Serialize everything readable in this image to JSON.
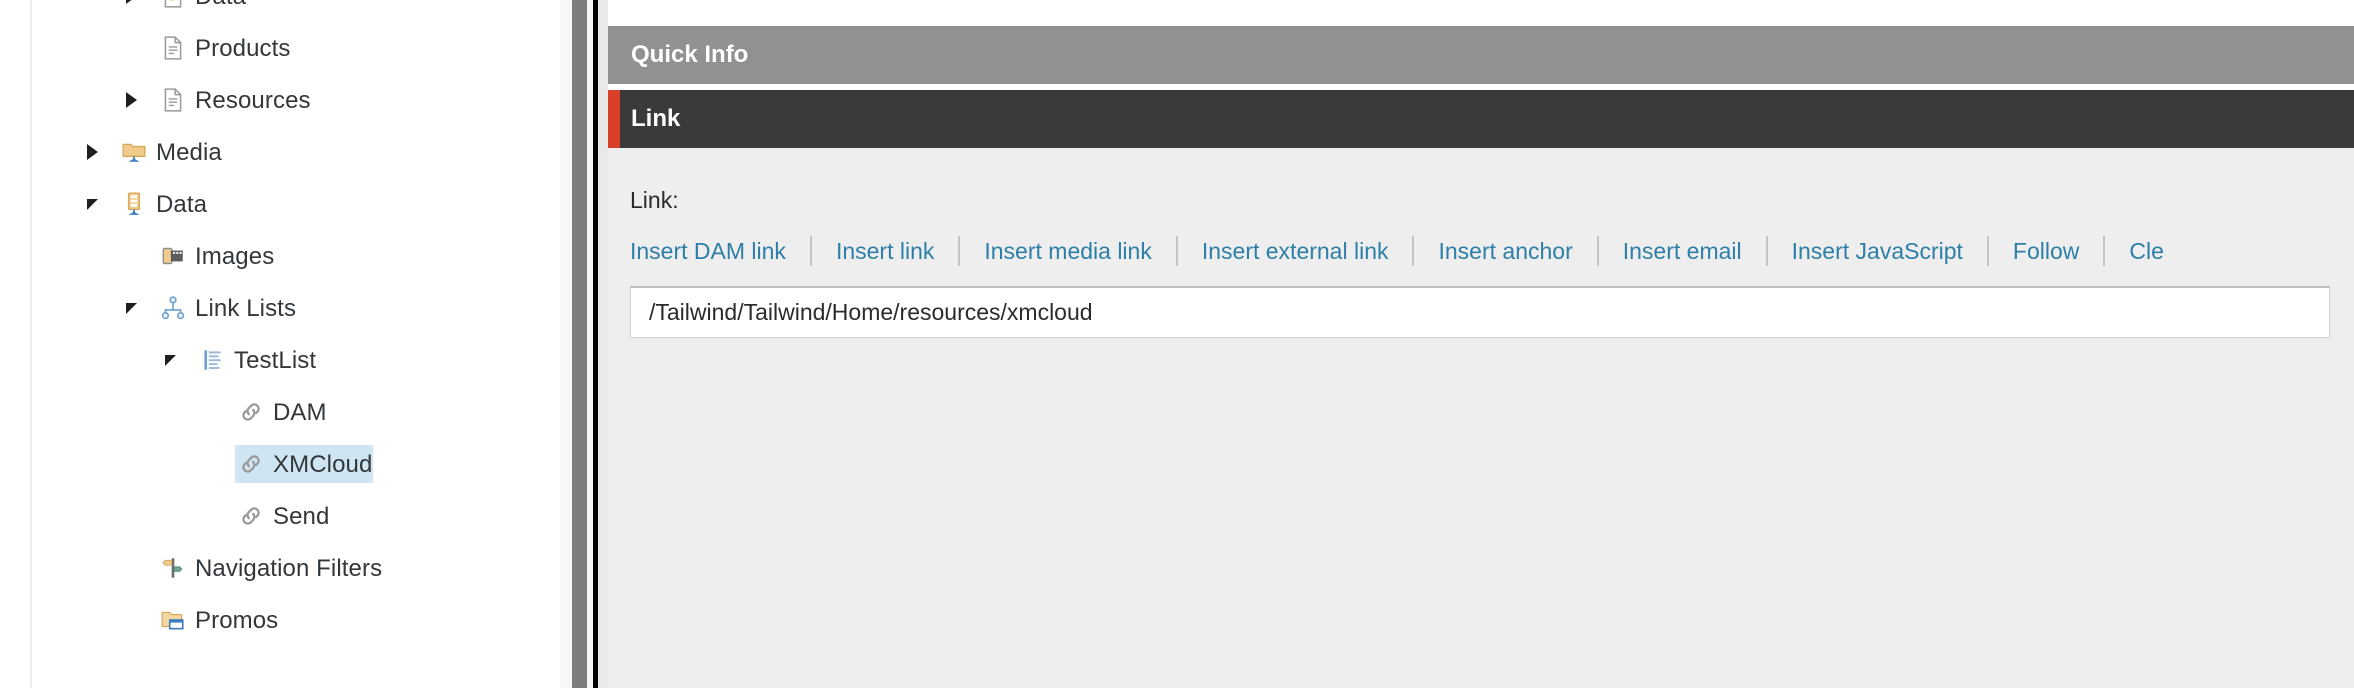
{
  "tree": {
    "name": "content-tree",
    "items": [
      {
        "label": "Data",
        "icon": "document-data-icon",
        "toggle": "collapsed",
        "indent": 3,
        "selected": false,
        "clipped": false
      },
      {
        "label": "Products",
        "icon": "document-icon",
        "toggle": "none",
        "indent": 3,
        "selected": false,
        "clipped": false
      },
      {
        "label": "Resources",
        "icon": "document-icon",
        "toggle": "collapsed",
        "indent": 3,
        "selected": false,
        "clipped": false
      },
      {
        "label": "Media",
        "icon": "media-folder-icon",
        "toggle": "collapsed",
        "indent": 2,
        "selected": false,
        "clipped": false
      },
      {
        "label": "Data",
        "icon": "data-drawer-icon",
        "toggle": "expanded",
        "indent": 2,
        "selected": false,
        "clipped": false
      },
      {
        "label": "Images",
        "icon": "film-roll-icon",
        "toggle": "none",
        "indent": 3,
        "selected": false,
        "clipped": false
      },
      {
        "label": "Link Lists",
        "icon": "node-tree-icon",
        "toggle": "expanded",
        "indent": 3,
        "selected": false,
        "clipped": false
      },
      {
        "label": "TestList",
        "icon": "list-lines-icon",
        "toggle": "expanded",
        "indent": 4,
        "selected": false,
        "clipped": false
      },
      {
        "label": "DAM",
        "icon": "chain-link-icon",
        "toggle": "none",
        "indent": 5,
        "selected": false,
        "clipped": false
      },
      {
        "label": "XMCloud",
        "icon": "chain-link-icon",
        "toggle": "none",
        "indent": 5,
        "selected": true,
        "clipped": false
      },
      {
        "label": "Send",
        "icon": "chain-link-icon",
        "toggle": "none",
        "indent": 5,
        "selected": false,
        "clipped": false
      },
      {
        "label": "Navigation Filters",
        "icon": "signpost-icon",
        "toggle": "none",
        "indent": 3,
        "selected": false,
        "clipped": false
      },
      {
        "label": "Promos",
        "icon": "folder-window-icon",
        "toggle": "none",
        "indent": 3,
        "selected": false,
        "clipped": false
      }
    ]
  },
  "sections": {
    "quick_info": {
      "title": "Quick Info"
    },
    "link": {
      "title": "Link"
    }
  },
  "field": {
    "label": "Link:",
    "value": "/Tailwind/Tailwind/Home/resources/xmcloud",
    "placeholder": "",
    "toolbar": [
      {
        "label": "Insert DAM link"
      },
      {
        "label": "Insert link"
      },
      {
        "label": "Insert media link"
      },
      {
        "label": "Insert external link"
      },
      {
        "label": "Insert anchor"
      },
      {
        "label": "Insert email"
      },
      {
        "label": "Insert JavaScript"
      },
      {
        "label": "Follow"
      },
      {
        "label": "Cle"
      }
    ]
  },
  "colors": {
    "quick_info_header": "#919191",
    "link_header": "#3a3a3a",
    "accent_bar": "#d8402a",
    "field_background": "#eeeeee",
    "link_text": "#2d7fa8",
    "selection": "#cfe6f2",
    "tree_text": "#32373c"
  },
  "scroll": {
    "orientation": "vertical",
    "thumb_label": "tree-scrollbar-thumb"
  }
}
